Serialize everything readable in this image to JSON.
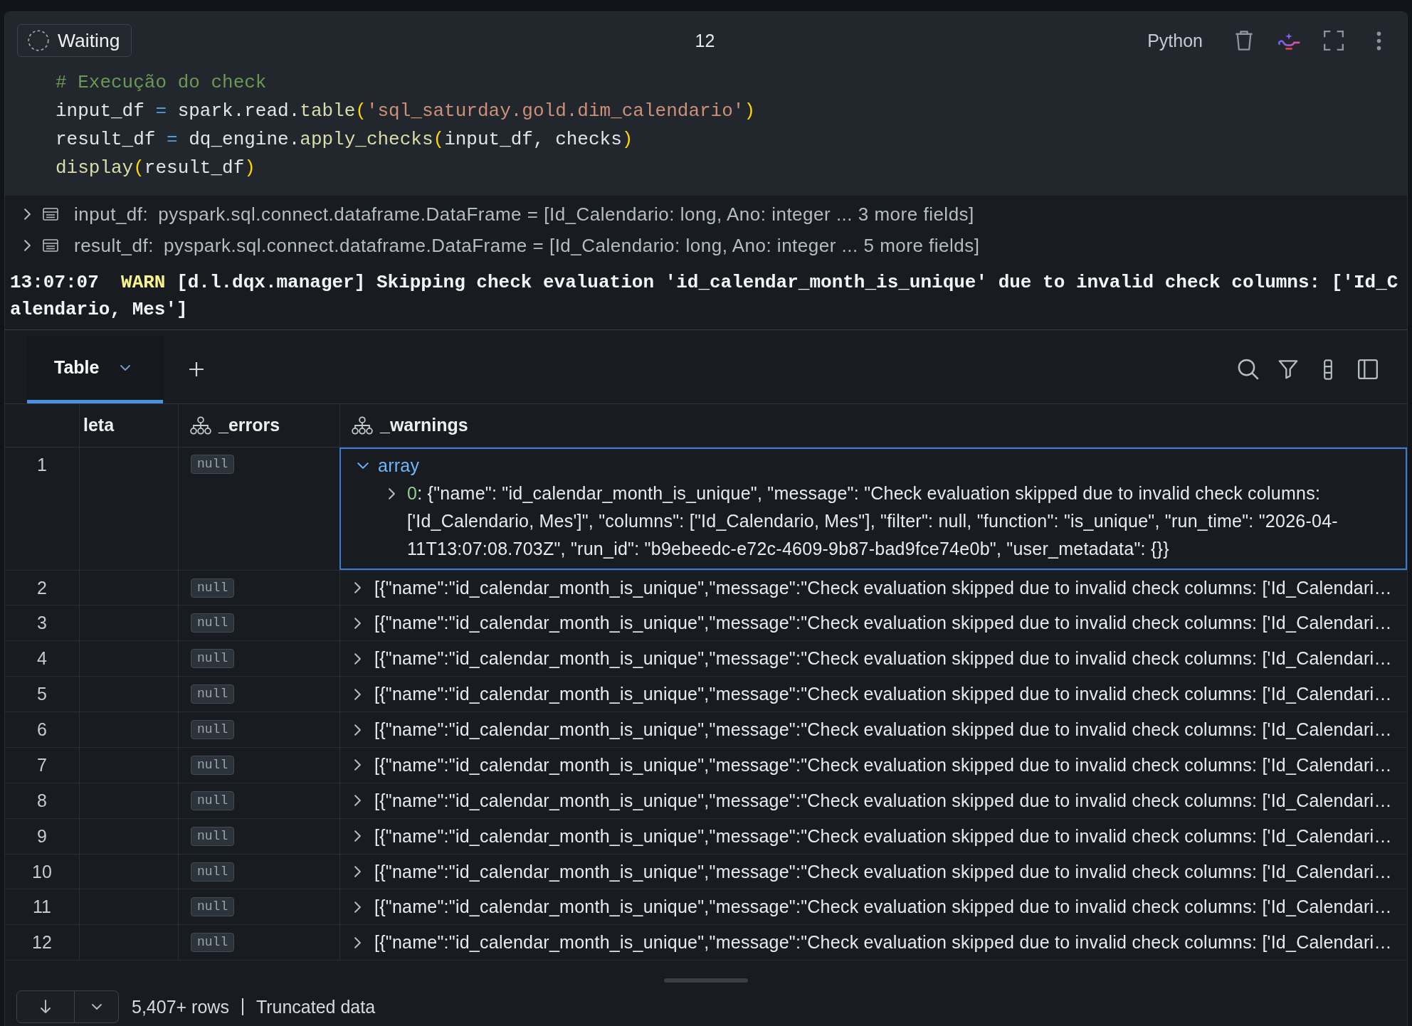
{
  "cell": {
    "status": "Waiting",
    "execution_count": "12",
    "language": "Python",
    "code_lines": [
      {
        "tokens": [
          {
            "kind": "comment",
            "text": "# Execução do check"
          }
        ]
      },
      {
        "tokens": [
          {
            "kind": "name",
            "text": "input_df "
          },
          {
            "kind": "operator",
            "text": "="
          },
          {
            "kind": "name",
            "text": " spark.read."
          },
          {
            "kind": "function",
            "text": "table"
          },
          {
            "kind": "bracket",
            "text": "("
          },
          {
            "kind": "string",
            "text": "'sql_saturday.gold.dim_calendario'"
          },
          {
            "kind": "bracket",
            "text": ")"
          }
        ]
      },
      {
        "tokens": [
          {
            "kind": "name",
            "text": "result_df "
          },
          {
            "kind": "operator",
            "text": "="
          },
          {
            "kind": "name",
            "text": " dq_engine."
          },
          {
            "kind": "function",
            "text": "apply_checks"
          },
          {
            "kind": "bracket",
            "text": "("
          },
          {
            "kind": "name",
            "text": "input_df, checks"
          },
          {
            "kind": "bracket",
            "text": ")"
          }
        ]
      },
      {
        "tokens": [
          {
            "kind": "function",
            "text": "display"
          },
          {
            "kind": "bracket",
            "text": "("
          },
          {
            "kind": "name",
            "text": "result_df"
          },
          {
            "kind": "bracket",
            "text": ")"
          }
        ]
      }
    ]
  },
  "outputs": [
    {
      "name": "input_df:",
      "schema": "pyspark.sql.connect.dataframe.DataFrame = [Id_Calendario: long, Ano: integer ... 3 more fields]",
      "expanded": false
    },
    {
      "name": "result_df:",
      "schema": "pyspark.sql.connect.dataframe.DataFrame = [Id_Calendario: long, Ano: integer ... 5 more fields]",
      "expanded": false
    }
  ],
  "log": {
    "time": "13:07:07",
    "level": "WARN",
    "message": "[d.l.dqx.manager] Skipping check evaluation 'id_calendar_month_is_unique' due to invalid check columns: ['Id_Calendario, Mes']"
  },
  "results": {
    "tabs": [
      {
        "label": "Table",
        "selected": true
      }
    ],
    "table": {
      "columns": [
        {
          "label": "leta",
          "kind": "plain"
        },
        {
          "label": "_errors",
          "kind": "struct"
        },
        {
          "label": "_warnings",
          "kind": "struct"
        }
      ],
      "rows": [
        {
          "number": "1",
          "errors": "null",
          "expanded": true,
          "selected": true,
          "type": "array",
          "items": [
            {
              "key": "0",
              "value": ": {\"name\": \"id_calendar_month_is_unique\", \"message\": \"Check evaluation skipped due to invalid check columns: ['Id_Calendario, Mes']\", \"columns\": [\"Id_Calendario, Mes\"], \"filter\": null, \"function\": \"is_unique\", \"run_time\": \"2026-04-11T13:07:08.703Z\", \"run_id\": \"b9ebeedc-e72c-4609-9b87-bad9fce74e0b\", \"user_metadata\": {}}",
              "expanded": false
            }
          ]
        },
        {
          "number": "2",
          "errors": "null",
          "expanded": false,
          "selected": false,
          "summary": "[{\"name\":\"id_calendar_month_is_unique\",\"message\":\"Check evaluation skipped due to invalid check columns: ['Id_Calendari…"
        },
        {
          "number": "3",
          "errors": "null",
          "expanded": false,
          "selected": false,
          "summary": "[{\"name\":\"id_calendar_month_is_unique\",\"message\":\"Check evaluation skipped due to invalid check columns: ['Id_Calendari…"
        },
        {
          "number": "4",
          "errors": "null",
          "expanded": false,
          "selected": false,
          "summary": "[{\"name\":\"id_calendar_month_is_unique\",\"message\":\"Check evaluation skipped due to invalid check columns: ['Id_Calendari…"
        },
        {
          "number": "5",
          "errors": "null",
          "expanded": false,
          "selected": false,
          "summary": "[{\"name\":\"id_calendar_month_is_unique\",\"message\":\"Check evaluation skipped due to invalid check columns: ['Id_Calendari…"
        },
        {
          "number": "6",
          "errors": "null",
          "expanded": false,
          "selected": false,
          "summary": "[{\"name\":\"id_calendar_month_is_unique\",\"message\":\"Check evaluation skipped due to invalid check columns: ['Id_Calendari…"
        },
        {
          "number": "7",
          "errors": "null",
          "expanded": false,
          "selected": false,
          "summary": "[{\"name\":\"id_calendar_month_is_unique\",\"message\":\"Check evaluation skipped due to invalid check columns: ['Id_Calendari…"
        },
        {
          "number": "8",
          "errors": "null",
          "expanded": false,
          "selected": false,
          "summary": "[{\"name\":\"id_calendar_month_is_unique\",\"message\":\"Check evaluation skipped due to invalid check columns: ['Id_Calendari…"
        },
        {
          "number": "9",
          "errors": "null",
          "expanded": false,
          "selected": false,
          "summary": "[{\"name\":\"id_calendar_month_is_unique\",\"message\":\"Check evaluation skipped due to invalid check columns: ['Id_Calendari…"
        },
        {
          "number": "10",
          "errors": "null",
          "expanded": false,
          "selected": false,
          "summary": "[{\"name\":\"id_calendar_month_is_unique\",\"message\":\"Check evaluation skipped due to invalid check columns: ['Id_Calendari…"
        },
        {
          "number": "11",
          "errors": "null",
          "expanded": false,
          "selected": false,
          "summary": "[{\"name\":\"id_calendar_month_is_unique\",\"message\":\"Check evaluation skipped due to invalid check columns: ['Id_Calendari…"
        },
        {
          "number": "12",
          "errors": "null",
          "expanded": false,
          "selected": false,
          "summary": "[{\"name\":\"id_calendar_month_is_unique\",\"message\":\"Check evaluation skipped due to invalid check columns: ['Id_Calendari…"
        }
      ]
    },
    "footer": {
      "row_count": "5,407+ rows",
      "note": "Truncated data"
    }
  }
}
